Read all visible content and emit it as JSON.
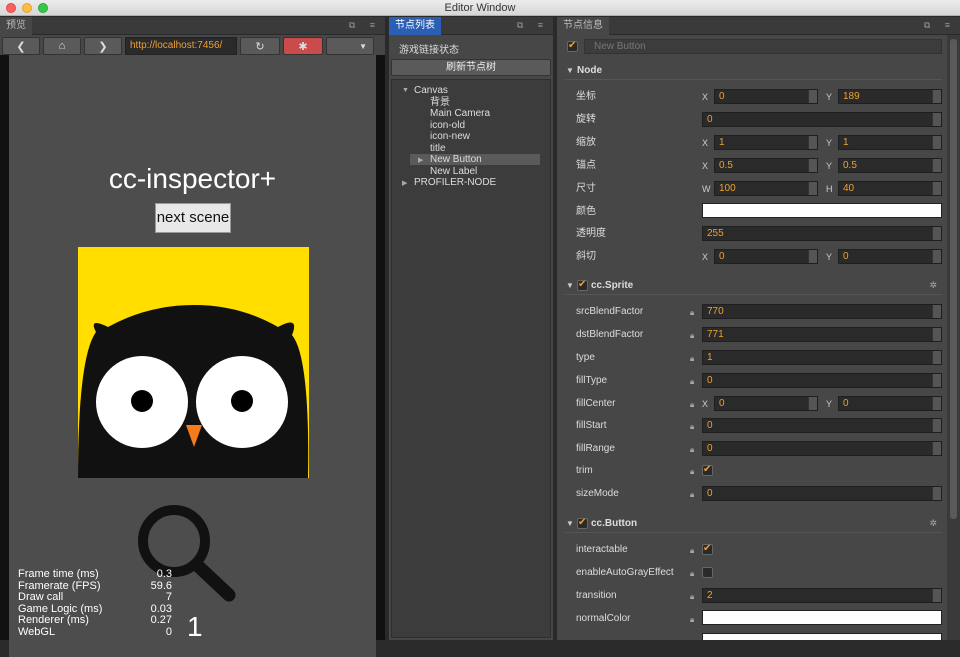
{
  "window": {
    "title": "Editor Window"
  },
  "preview": {
    "tab": "预览",
    "url": "http://localhost:7456/",
    "game_title": "cc-inspector+",
    "next_button": "next scene",
    "stats": [
      {
        "label": "Frame time (ms)",
        "value": "0.3"
      },
      {
        "label": "Framerate (FPS)",
        "value": "59.6"
      },
      {
        "label": "Draw call",
        "value": "7"
      },
      {
        "label": "Game Logic (ms)",
        "value": "0.03"
      },
      {
        "label": "Renderer (ms)",
        "value": "0.27"
      },
      {
        "label": "WebGL",
        "value": "0"
      }
    ],
    "big_number": "1"
  },
  "tree_panel": {
    "tab": "节点列表",
    "status": "游戏链接状态",
    "refresh": "刷新节点树",
    "nodes": [
      {
        "label": "Canvas",
        "depth": 0,
        "expanded": true
      },
      {
        "label": "背景",
        "depth": 1
      },
      {
        "label": "Main Camera",
        "depth": 1
      },
      {
        "label": "icon-old",
        "depth": 1
      },
      {
        "label": "icon-new",
        "depth": 1
      },
      {
        "label": "title",
        "depth": 1
      },
      {
        "label": "New Button",
        "depth": 1,
        "selected": true
      },
      {
        "label": "New Label",
        "depth": 1
      },
      {
        "label": "PROFILER-NODE",
        "depth": 0,
        "expanded": false
      }
    ]
  },
  "info_panel": {
    "tab": "节点信息",
    "node_name": "New Button",
    "node_section": "Node",
    "position": {
      "label": "坐标",
      "x": "0",
      "y": "189"
    },
    "rotation": {
      "label": "旋转",
      "value": "0"
    },
    "scale": {
      "label": "缩放",
      "x": "1",
      "y": "1"
    },
    "anchor": {
      "label": "锚点",
      "x": "0.5",
      "y": "0.5"
    },
    "size": {
      "label": "尺寸",
      "w": "100",
      "h": "40"
    },
    "color": {
      "label": "颜色",
      "value": "#ffffff"
    },
    "opacity": {
      "label": "透明度",
      "value": "255"
    },
    "skew": {
      "label": "斜切",
      "x": "0",
      "y": "0"
    },
    "axis": {
      "x": "X",
      "y": "Y",
      "w": "W",
      "h": "H"
    },
    "sprite_section": "cc.Sprite",
    "sprite": {
      "srcBlendFactor": "770",
      "dstBlendFactor": "771",
      "type": "1",
      "fillType": "0",
      "fillCenter": {
        "x": "0",
        "y": "0"
      },
      "fillStart": "0",
      "fillRange": "0",
      "trim": true,
      "sizeMode": "0"
    },
    "sprite_labels": {
      "srcBlendFactor": "srcBlendFactor",
      "dstBlendFactor": "dstBlendFactor",
      "type": "type",
      "fillType": "fillType",
      "fillCenter": "fillCenter",
      "fillStart": "fillStart",
      "fillRange": "fillRange",
      "trim": "trim",
      "sizeMode": "sizeMode"
    },
    "button_section": "cc.Button",
    "button_labels": {
      "interactable": "interactable",
      "enableAutoGrayEffect": "enableAutoGrayEffect",
      "transition": "transition",
      "normalColor": "normalColor"
    },
    "button": {
      "interactable": true,
      "enableAutoGrayEffect": false,
      "transition": "2",
      "normalColor": "#ffffff"
    }
  },
  "icons": [
    "back-icon",
    "home-icon",
    "forward-icon",
    "reload-icon",
    "bug-icon",
    "dropdown-icon",
    "lock-icon",
    "gear-icon",
    "search-icon"
  ],
  "colors": {
    "accent": "#f0a030",
    "tab_active": "#2b5fb3",
    "owl_bg": "#ffde00",
    "debug": "#c94b4b"
  }
}
